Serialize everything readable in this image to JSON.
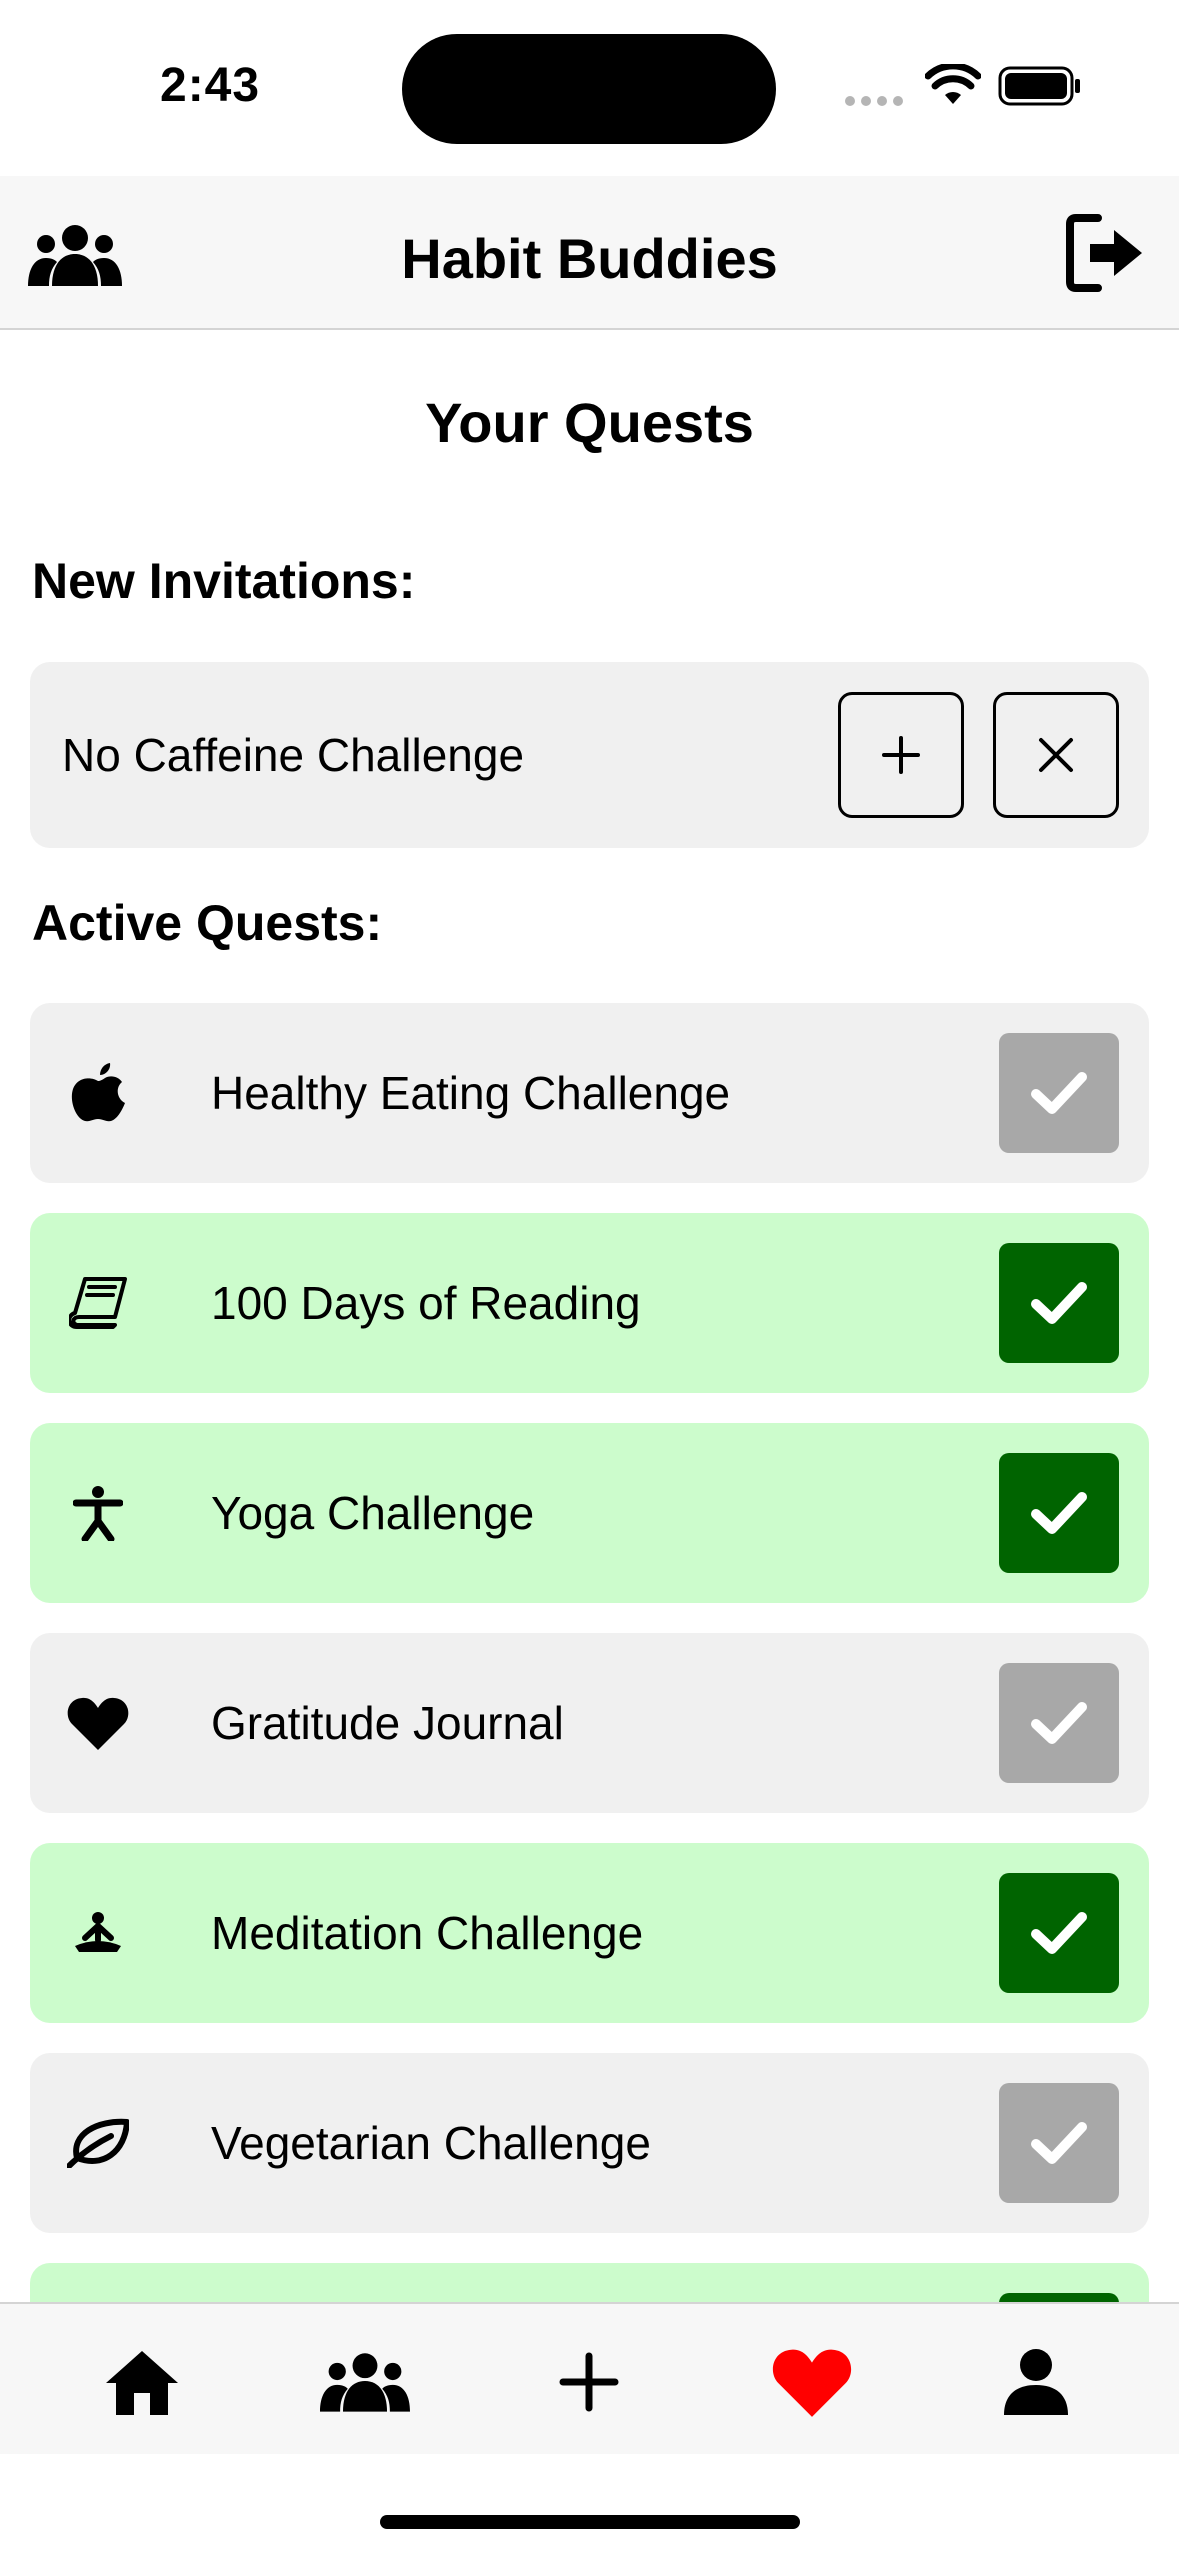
{
  "status_bar": {
    "time": "2:43"
  },
  "header": {
    "title": "Habit Buddies",
    "left_icon": "group-icon",
    "right_icon": "sign-out-icon"
  },
  "page_title": "Your Quests",
  "invitations": {
    "heading": "New Invitations:",
    "items": [
      {
        "name": "No Caffeine Challenge",
        "accept_icon": "plus-icon",
        "decline_icon": "close-icon"
      }
    ]
  },
  "active": {
    "heading": "Active Quests:",
    "items": [
      {
        "name": "Healthy Eating Challenge",
        "icon": "apple-icon",
        "completed": false
      },
      {
        "name": "100 Days of Reading",
        "icon": "book-icon",
        "completed": true
      },
      {
        "name": "Yoga Challenge",
        "icon": "yoga-icon",
        "completed": true
      },
      {
        "name": "Gratitude Journal",
        "icon": "heart-icon",
        "completed": false
      },
      {
        "name": "Meditation Challenge",
        "icon": "meditation-icon",
        "completed": true
      },
      {
        "name": "Vegetarian Challenge",
        "icon": "leaf-icon",
        "completed": false
      }
    ]
  },
  "tab_bar": {
    "tabs": [
      {
        "icon": "home-icon"
      },
      {
        "icon": "group-icon"
      },
      {
        "icon": "plus-icon"
      },
      {
        "icon": "heart-icon",
        "active": true
      },
      {
        "icon": "person-icon"
      }
    ],
    "active_color": "#ff0000"
  },
  "colors": {
    "completed_bg": "#ccfccc",
    "pending_bg": "#f0f0f0",
    "check_done": "#006400",
    "check_pending": "#a8a8a8"
  }
}
